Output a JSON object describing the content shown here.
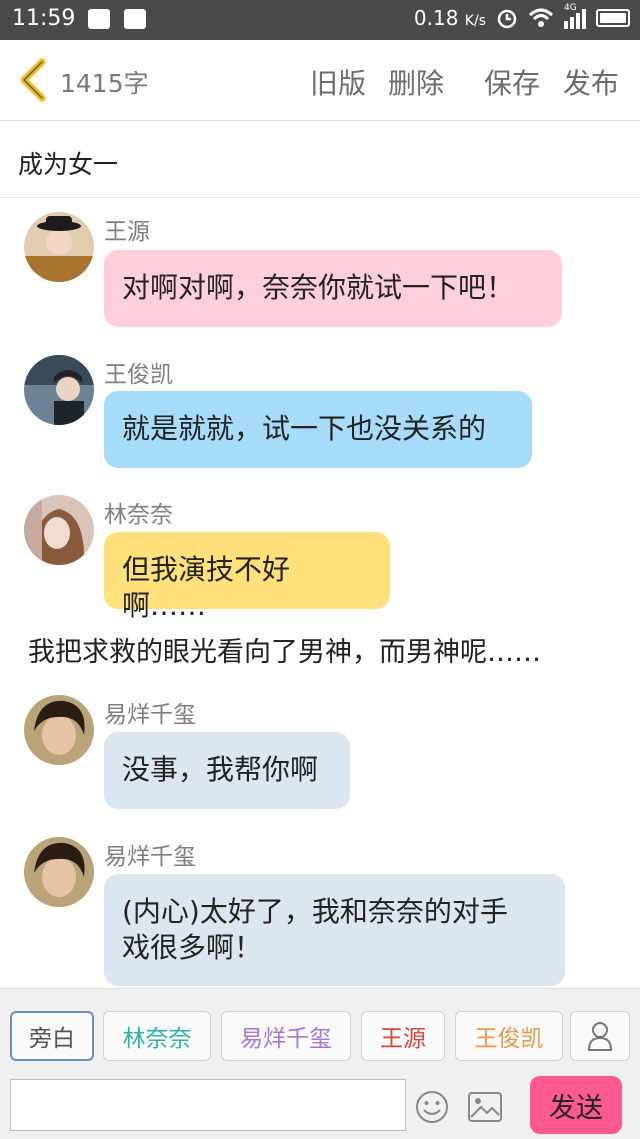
{
  "status": {
    "time": "11:59",
    "speed": "0.18",
    "speed_unit": "K/s",
    "network": "4G"
  },
  "header": {
    "word_count": "1415字",
    "old_version": "旧版",
    "delete": "删除",
    "save": "保存",
    "publish": "发布"
  },
  "story_title": "成为女一",
  "messages": [
    {
      "name": "王源",
      "text": "对啊对啊，奈奈你就试一下吧！",
      "bubble_color": "#ffd0dc"
    },
    {
      "name": "王俊凯",
      "text": "就是就就，试一下也没关系的",
      "bubble_color": "#a6dcfa"
    },
    {
      "name": "林奈奈",
      "text": "但我演技不好啊……",
      "bubble_color": "#ffe07a"
    },
    {
      "name": "易烊千玺",
      "text": "没事，我帮你啊",
      "bubble_color": "#dde6ee"
    },
    {
      "name": "易烊千玺",
      "line1": "(内心)太好了，我和奈奈的对手",
      "line2": "戏很多啊！",
      "bubble_color": "#dde6ee"
    }
  ],
  "narration": "我把求救的眼光看向了男神，而男神呢……",
  "roles": [
    {
      "label": "旁白",
      "color": "#555555"
    },
    {
      "label": "林奈奈",
      "color": "#2fb0a6"
    },
    {
      "label": "易烊千玺",
      "color": "#a279d6"
    },
    {
      "label": "王源",
      "color": "#d64a35"
    },
    {
      "label": "王俊凯",
      "color": "#ec9a4a"
    }
  ],
  "composer": {
    "input_value": "",
    "send_label": "发送"
  },
  "colors": {
    "accent_back": "#f0c028",
    "send_bg": "#ff5a8e"
  }
}
